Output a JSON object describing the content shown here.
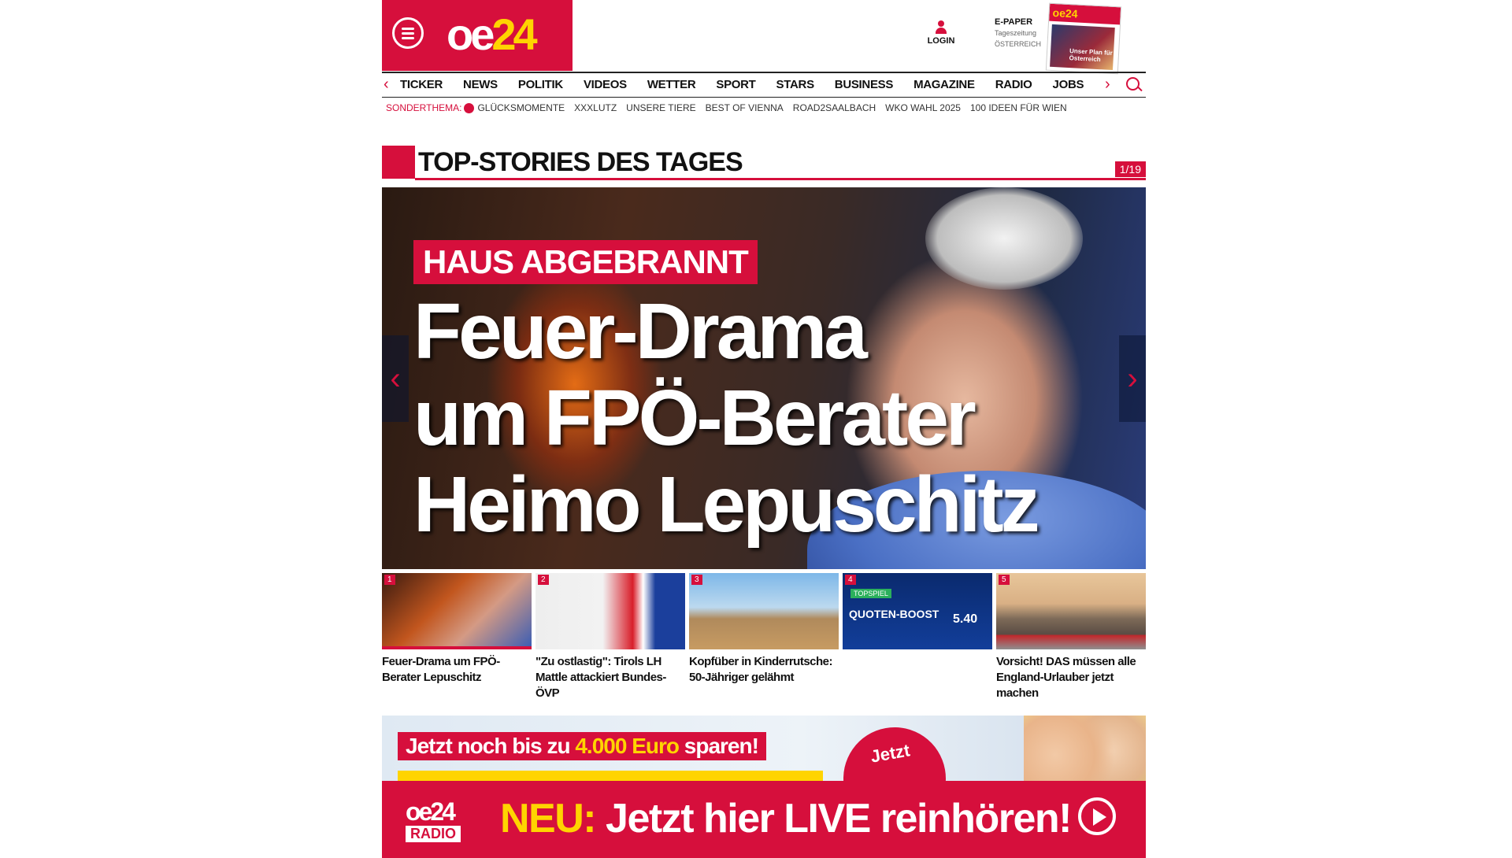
{
  "header": {
    "logo": {
      "text_main": "oe",
      "text_accent": "24"
    },
    "login_label": "LOGIN",
    "epaper": {
      "title": "E-PAPER",
      "line2": "Tageszeitung",
      "line3": "ÖSTERREICH",
      "thumb_brand": "oe24",
      "thumb_caption": "Unser Plan für Österreich"
    }
  },
  "nav": {
    "items": [
      "TICKER",
      "NEWS",
      "POLITIK",
      "VIDEOS",
      "WETTER",
      "SPORT",
      "STARS",
      "BUSINESS",
      "MAGAZINE",
      "RADIO",
      "JOBS"
    ],
    "left_arrow": "‹",
    "right_arrow": "›"
  },
  "subnav": {
    "lead": "SONDERTHEMA:",
    "items": [
      "GLÜCKSMOMENTE",
      "XXXLUTZ",
      "UNSERE TIERE",
      "BEST OF VIENNA",
      "ROAD2SAALBACH",
      "WKO WAHL 2025",
      "100 IDEEN FÜR WIEN"
    ]
  },
  "section": {
    "title": "TOP-STORIES DES TAGES",
    "counter": "1/19"
  },
  "hero": {
    "tag": "HAUS ABGEBRANNT",
    "headline_line1": "Feuer-Drama",
    "headline_line2": "um FPÖ-Berater",
    "headline_line3": "Heimo Lepuschitz",
    "prev": "‹",
    "next": "›"
  },
  "thumbs": [
    {
      "num": "1",
      "caption": "Feuer-Drama um FPÖ-Berater Lepuschitz"
    },
    {
      "num": "2",
      "caption": "\"Zu ostlastig\": Tirols LH Mattle attackiert Bundes-ÖVP"
    },
    {
      "num": "3",
      "caption": "Kopfüber in Kinderrutsche: 50-Jähriger gelähmt"
    },
    {
      "num": "4",
      "caption": "",
      "ad_badge": "TOPSPIEL",
      "ad_title": "QUOTEN-BOOST",
      "ad_value": "5.40"
    },
    {
      "num": "5",
      "caption": "Vorsicht! DAS müssen alle England-Urlauber jetzt machen"
    }
  ],
  "ad": {
    "pill_pre": "Jetzt noch bis zu ",
    "pill_amount": "4.000 Euro",
    "pill_post": " sparen!",
    "circle_text": "Jetzt"
  },
  "radio": {
    "logo_top": "oe24",
    "logo_bottom": "RADIO",
    "msg_accent": "NEU:",
    "msg_rest": " Jetzt hier LIVE reinhören!"
  },
  "colors": {
    "brand_red": "#d60f3c",
    "accent_yellow": "#ffd400"
  }
}
